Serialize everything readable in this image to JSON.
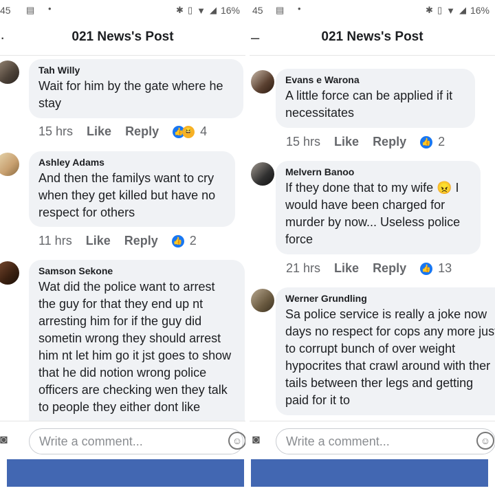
{
  "status_bar": {
    "time": "45",
    "battery": "16%"
  },
  "post_title": "021 News's Post",
  "composer_placeholder": "Write a comment...",
  "left_comments": [
    {
      "name": "Tah Willy",
      "text": "Wait for him by the gate where he stay",
      "time": "15 hrs",
      "like": "Like",
      "reply": "Reply",
      "reactions": "4"
    },
    {
      "name": "Ashley Adams",
      "text": "And then the familys want to cry when they get killed but have no respect for others",
      "time": "11 hrs",
      "like": "Like",
      "reply": "Reply",
      "reactions": "2"
    },
    {
      "name": "Samson Sekone",
      "text": "Wat did the police  want to arrest the guy for that they end up nt arresting  him for if the guy did sometin  wrong they should  arrest him nt let him go it jst goes to show  that he did notion wrong police officers  are checking  wen  they talk to people  they either  dont like"
    }
  ],
  "right_comments": [
    {
      "name": "Evans e Warona",
      "text": "A little force can be applied if it necessitates",
      "time": "15 hrs",
      "like": "Like",
      "reply": "Reply",
      "reactions": "2"
    },
    {
      "name": "Melvern Banoo",
      "text": "If they done that to my wife 😠 I would have been charged for murder by now... Useless police force",
      "time": "21 hrs",
      "like": "Like",
      "reply": "Reply",
      "reactions": "13"
    },
    {
      "name": "Werner Grundling",
      "text": "Sa police service is really a joke now days no respect for cops any more just to corrupt  bunch of over weight hypocrites that crawl around  with ther tails between ther legs and getting paid for it to"
    }
  ]
}
